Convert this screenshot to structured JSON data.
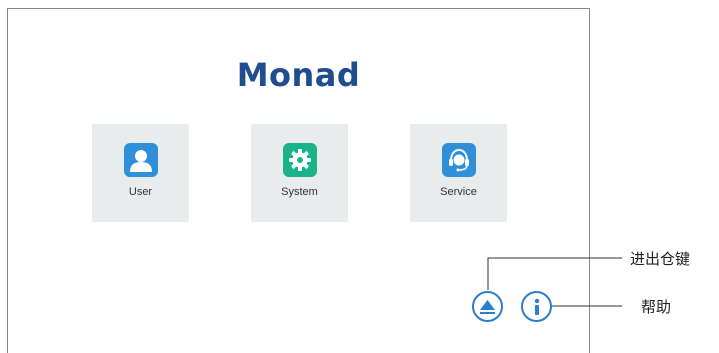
{
  "brand": {
    "logo_text": "Monad",
    "color": "#1f4d8f"
  },
  "menu": {
    "items": [
      {
        "label": "User",
        "icon": "user-icon",
        "icon_color": "#2f8fd8"
      },
      {
        "label": "System",
        "icon": "gear-icon",
        "icon_color": "#19b38a"
      },
      {
        "label": "Service",
        "icon": "headset-icon",
        "icon_color": "#2f8fd8"
      }
    ]
  },
  "controls": {
    "eject": {
      "icon": "eject-icon",
      "callout": "进出仓键"
    },
    "help": {
      "icon": "info-icon",
      "callout": "帮助"
    },
    "accent": "#2b7dd0"
  }
}
